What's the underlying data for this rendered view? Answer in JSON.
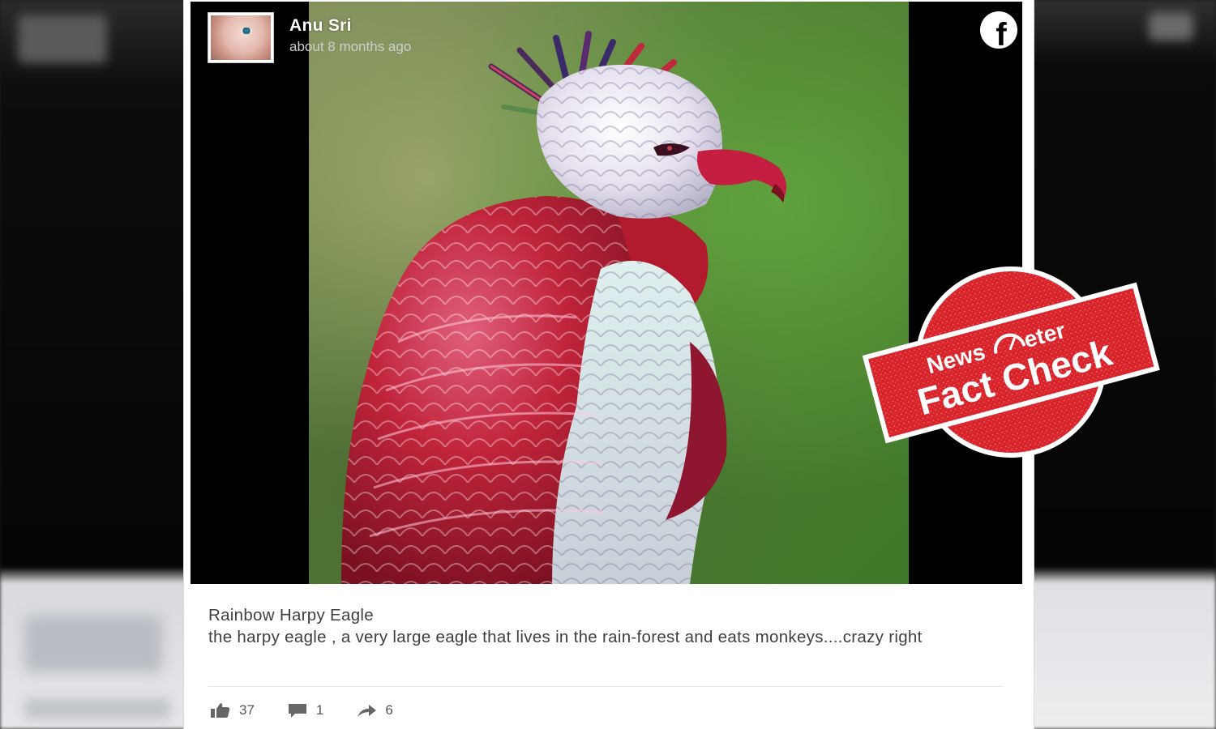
{
  "post": {
    "author": "Anu Sri",
    "time": "about 8 months ago",
    "platform_icon": "facebook-icon",
    "caption_title": "Rainbow Harpy Eagle",
    "caption_body": "the harpy eagle , a very large eagle that lives in the rain-forest and eats monkeys....crazy right",
    "actions": {
      "likes": "37",
      "comments": "1",
      "shares": "6"
    }
  },
  "stamp": {
    "brand_prefix": "News",
    "brand_suffix": "eter",
    "label": "Fact Check",
    "color": "#d8232a"
  }
}
